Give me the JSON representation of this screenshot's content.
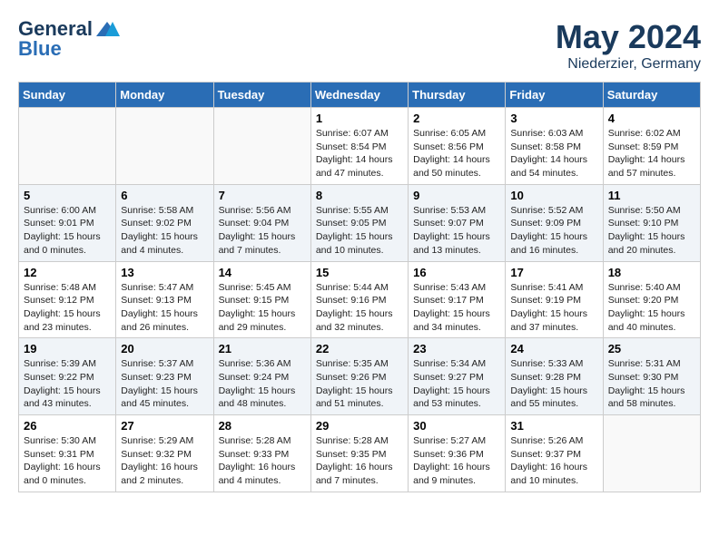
{
  "header": {
    "logo_line1": "General",
    "logo_line2": "Blue",
    "month_title": "May 2024",
    "location": "Niederzier, Germany"
  },
  "weekdays": [
    "Sunday",
    "Monday",
    "Tuesday",
    "Wednesday",
    "Thursday",
    "Friday",
    "Saturday"
  ],
  "weeks": [
    [
      {
        "day": "",
        "info": ""
      },
      {
        "day": "",
        "info": ""
      },
      {
        "day": "",
        "info": ""
      },
      {
        "day": "1",
        "info": "Sunrise: 6:07 AM\nSunset: 8:54 PM\nDaylight: 14 hours\nand 47 minutes."
      },
      {
        "day": "2",
        "info": "Sunrise: 6:05 AM\nSunset: 8:56 PM\nDaylight: 14 hours\nand 50 minutes."
      },
      {
        "day": "3",
        "info": "Sunrise: 6:03 AM\nSunset: 8:58 PM\nDaylight: 14 hours\nand 54 minutes."
      },
      {
        "day": "4",
        "info": "Sunrise: 6:02 AM\nSunset: 8:59 PM\nDaylight: 14 hours\nand 57 minutes."
      }
    ],
    [
      {
        "day": "5",
        "info": "Sunrise: 6:00 AM\nSunset: 9:01 PM\nDaylight: 15 hours\nand 0 minutes."
      },
      {
        "day": "6",
        "info": "Sunrise: 5:58 AM\nSunset: 9:02 PM\nDaylight: 15 hours\nand 4 minutes."
      },
      {
        "day": "7",
        "info": "Sunrise: 5:56 AM\nSunset: 9:04 PM\nDaylight: 15 hours\nand 7 minutes."
      },
      {
        "day": "8",
        "info": "Sunrise: 5:55 AM\nSunset: 9:05 PM\nDaylight: 15 hours\nand 10 minutes."
      },
      {
        "day": "9",
        "info": "Sunrise: 5:53 AM\nSunset: 9:07 PM\nDaylight: 15 hours\nand 13 minutes."
      },
      {
        "day": "10",
        "info": "Sunrise: 5:52 AM\nSunset: 9:09 PM\nDaylight: 15 hours\nand 16 minutes."
      },
      {
        "day": "11",
        "info": "Sunrise: 5:50 AM\nSunset: 9:10 PM\nDaylight: 15 hours\nand 20 minutes."
      }
    ],
    [
      {
        "day": "12",
        "info": "Sunrise: 5:48 AM\nSunset: 9:12 PM\nDaylight: 15 hours\nand 23 minutes."
      },
      {
        "day": "13",
        "info": "Sunrise: 5:47 AM\nSunset: 9:13 PM\nDaylight: 15 hours\nand 26 minutes."
      },
      {
        "day": "14",
        "info": "Sunrise: 5:45 AM\nSunset: 9:15 PM\nDaylight: 15 hours\nand 29 minutes."
      },
      {
        "day": "15",
        "info": "Sunrise: 5:44 AM\nSunset: 9:16 PM\nDaylight: 15 hours\nand 32 minutes."
      },
      {
        "day": "16",
        "info": "Sunrise: 5:43 AM\nSunset: 9:17 PM\nDaylight: 15 hours\nand 34 minutes."
      },
      {
        "day": "17",
        "info": "Sunrise: 5:41 AM\nSunset: 9:19 PM\nDaylight: 15 hours\nand 37 minutes."
      },
      {
        "day": "18",
        "info": "Sunrise: 5:40 AM\nSunset: 9:20 PM\nDaylight: 15 hours\nand 40 minutes."
      }
    ],
    [
      {
        "day": "19",
        "info": "Sunrise: 5:39 AM\nSunset: 9:22 PM\nDaylight: 15 hours\nand 43 minutes."
      },
      {
        "day": "20",
        "info": "Sunrise: 5:37 AM\nSunset: 9:23 PM\nDaylight: 15 hours\nand 45 minutes."
      },
      {
        "day": "21",
        "info": "Sunrise: 5:36 AM\nSunset: 9:24 PM\nDaylight: 15 hours\nand 48 minutes."
      },
      {
        "day": "22",
        "info": "Sunrise: 5:35 AM\nSunset: 9:26 PM\nDaylight: 15 hours\nand 51 minutes."
      },
      {
        "day": "23",
        "info": "Sunrise: 5:34 AM\nSunset: 9:27 PM\nDaylight: 15 hours\nand 53 minutes."
      },
      {
        "day": "24",
        "info": "Sunrise: 5:33 AM\nSunset: 9:28 PM\nDaylight: 15 hours\nand 55 minutes."
      },
      {
        "day": "25",
        "info": "Sunrise: 5:31 AM\nSunset: 9:30 PM\nDaylight: 15 hours\nand 58 minutes."
      }
    ],
    [
      {
        "day": "26",
        "info": "Sunrise: 5:30 AM\nSunset: 9:31 PM\nDaylight: 16 hours\nand 0 minutes."
      },
      {
        "day": "27",
        "info": "Sunrise: 5:29 AM\nSunset: 9:32 PM\nDaylight: 16 hours\nand 2 minutes."
      },
      {
        "day": "28",
        "info": "Sunrise: 5:28 AM\nSunset: 9:33 PM\nDaylight: 16 hours\nand 4 minutes."
      },
      {
        "day": "29",
        "info": "Sunrise: 5:28 AM\nSunset: 9:35 PM\nDaylight: 16 hours\nand 7 minutes."
      },
      {
        "day": "30",
        "info": "Sunrise: 5:27 AM\nSunset: 9:36 PM\nDaylight: 16 hours\nand 9 minutes."
      },
      {
        "day": "31",
        "info": "Sunrise: 5:26 AM\nSunset: 9:37 PM\nDaylight: 16 hours\nand 10 minutes."
      },
      {
        "day": "",
        "info": ""
      }
    ]
  ]
}
